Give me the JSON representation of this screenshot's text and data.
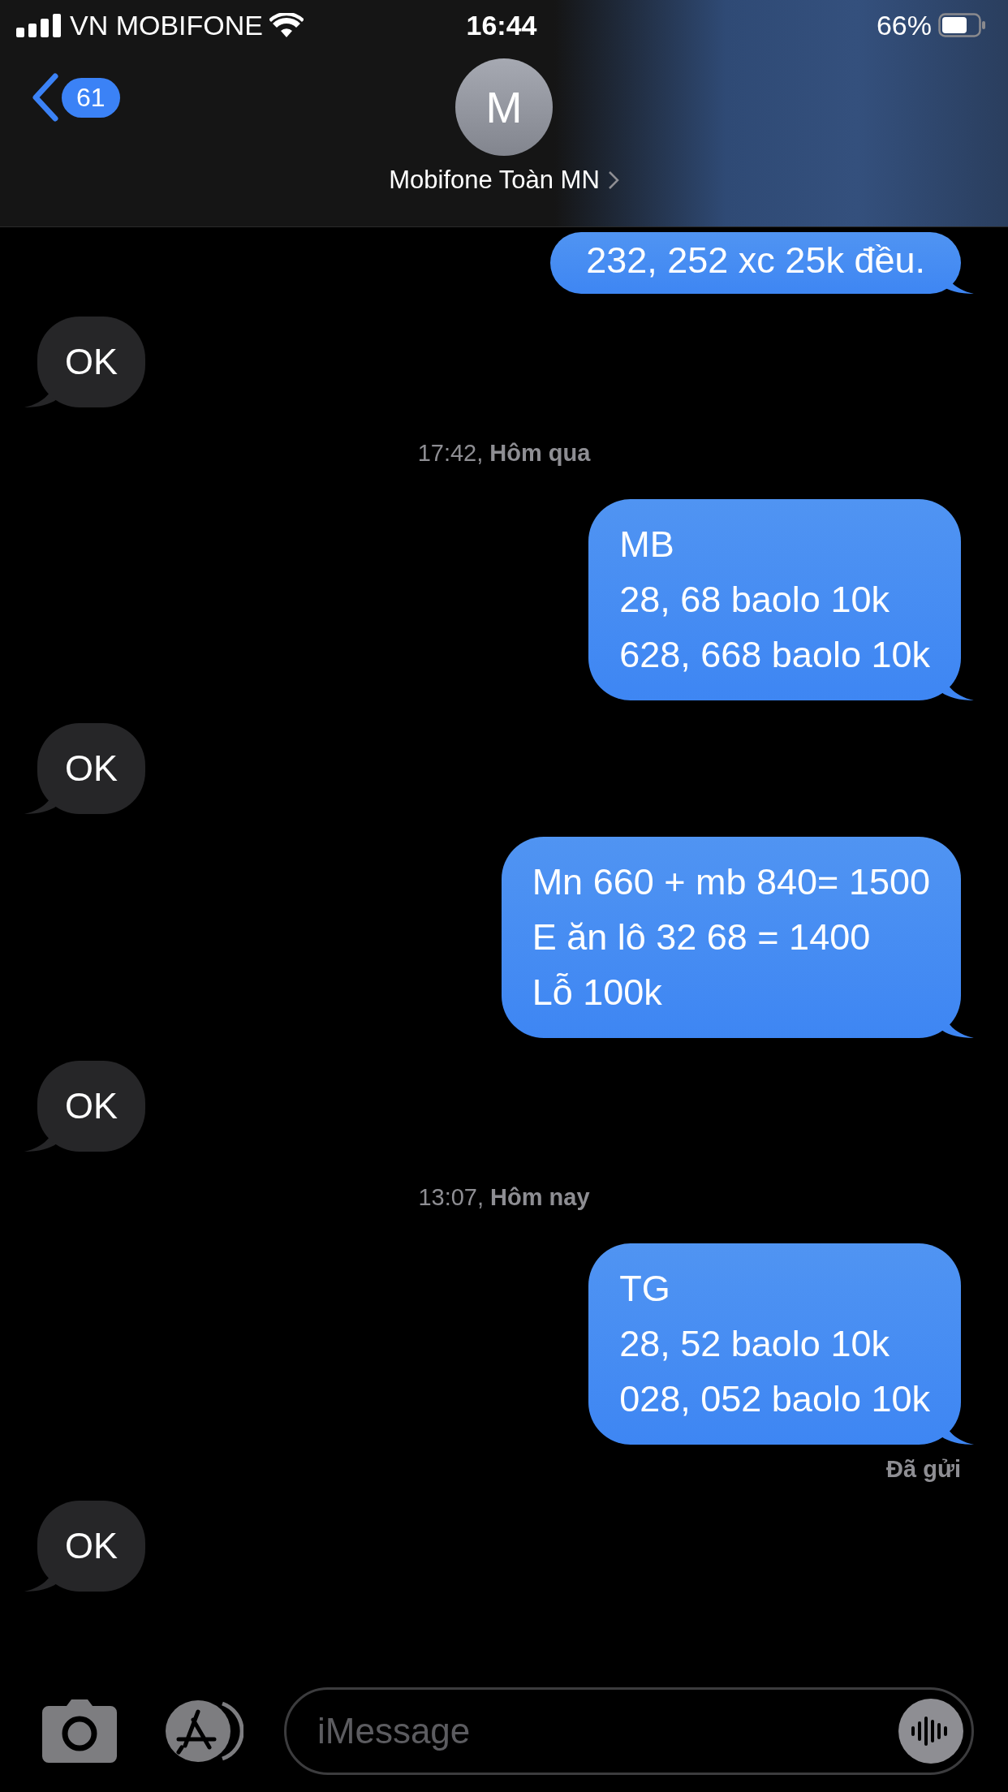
{
  "status_bar": {
    "carrier": "VN MOBIFONE",
    "time": "16:44",
    "battery": "66%"
  },
  "header": {
    "back_count": "61",
    "avatar_initial": "M",
    "contact_name": "Mobifone Toàn MN"
  },
  "messages": [
    {
      "kind": "sent",
      "lines": [
        "232, 252 xc 25k đều."
      ]
    },
    {
      "kind": "received",
      "lines": [
        "OK"
      ]
    },
    {
      "kind": "timestamp",
      "text": "17:42, **Hôm qua**"
    },
    {
      "kind": "sent",
      "lines": [
        "MB",
        "28, 68 baolo 10k",
        "628, 668 baolo 10k"
      ]
    },
    {
      "kind": "received",
      "lines": [
        "OK"
      ]
    },
    {
      "kind": "sent",
      "lines": [
        "Mn 660 + mb 840= 1500",
        "E ăn lô 32 68 = 1400",
        "Lỗ 100k"
      ]
    },
    {
      "kind": "received",
      "lines": [
        "OK"
      ]
    },
    {
      "kind": "timestamp",
      "text": "13:07, **Hôm nay**"
    },
    {
      "kind": "sent",
      "lines": [
        "TG",
        "28, 52 baolo 10k",
        "028, 052 baolo 10k"
      ],
      "status": "Đã gửi"
    },
    {
      "kind": "received",
      "lines": [
        "OK"
      ]
    }
  ],
  "composer": {
    "placeholder": "iMessage"
  }
}
